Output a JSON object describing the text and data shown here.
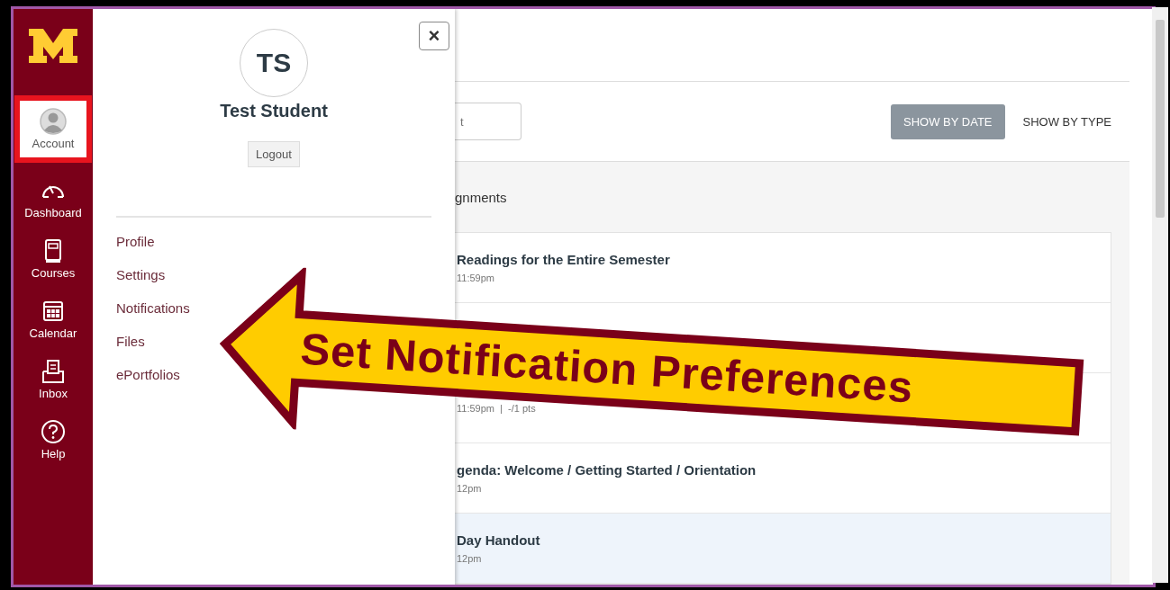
{
  "nav": {
    "items": [
      {
        "kind": "account",
        "label": "Account",
        "selected": true,
        "outlined": true
      },
      {
        "kind": "dashboard",
        "label": "Dashboard",
        "selected": false,
        "outlined": false
      },
      {
        "kind": "courses",
        "label": "Courses",
        "selected": false,
        "outlined": false
      },
      {
        "kind": "calendar",
        "label": "Calendar",
        "selected": false,
        "outlined": false
      },
      {
        "kind": "inbox",
        "label": "Inbox",
        "selected": false,
        "outlined": false
      },
      {
        "kind": "help",
        "label": "Help",
        "selected": false,
        "outlined": false
      }
    ]
  },
  "tray": {
    "close": "×",
    "initials": "TS",
    "name": "Test Student",
    "logout": "Logout",
    "links": [
      "Profile",
      "Settings",
      "Notifications",
      "Files",
      "ePortfolios"
    ]
  },
  "content": {
    "search": {
      "placeholder": "t"
    },
    "view_buttons": [
      {
        "label": "SHOW BY DATE",
        "selected": true
      },
      {
        "label": "SHOW BY TYPE",
        "selected": false
      }
    ],
    "group_title": "gnments",
    "rows": [
      {
        "title": "Readings for the Entire Semester",
        "meta": "11:59pm",
        "selected": false
      },
      {
        "title": "",
        "meta": "",
        "selected": false
      },
      {
        "title": "",
        "meta": "11:59pm  |  -/1 pts",
        "selected": false
      },
      {
        "title": "genda: Welcome / Getting Started / Orientation",
        "meta": "12pm",
        "selected": false
      },
      {
        "title": "Day Handout",
        "meta": "12pm",
        "selected": true
      }
    ]
  },
  "callout": {
    "text": "Set Notification Preferences"
  }
}
